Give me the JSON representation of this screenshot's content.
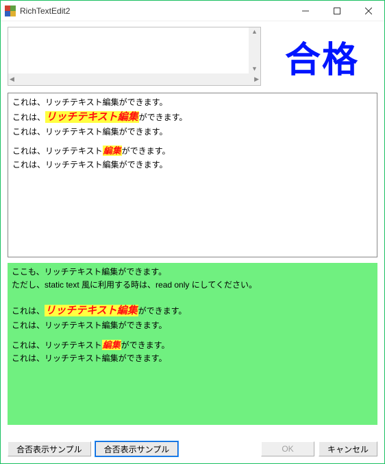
{
  "window": {
    "title": "RichTextEdit2"
  },
  "topright": {
    "pass_label": "合格"
  },
  "rich1": {
    "l1_full": "これは、リッチテキスト編集ができます。",
    "l2_pre": "これは、",
    "l2_mid": "リッチテキスト編集",
    "l2_post": "ができます。",
    "l3_full": "これは、リッチテキスト編集ができます。",
    "l4_pre": "これは、リッチテキスト",
    "l4_mid": "編集",
    "l4_post": "ができます。",
    "l5_full": "これは、リッチテキスト編集ができます。"
  },
  "rich2": {
    "intro1": "ここも、リッチテキスト編集ができます。",
    "intro2": "ただし、static text 風に利用する時は、read only にしてください。",
    "l2_pre": "これは、",
    "l2_mid": "リッチテキスト編集",
    "l2_post": "ができます。",
    "l3_full": "これは、リッチテキスト編集ができます。",
    "l4_pre": "これは、リッチテキスト",
    "l4_mid": "編集",
    "l4_post": "ができます。",
    "l5_full": "これは、リッチテキスト編集ができます。"
  },
  "buttons": {
    "sample1": "合否表示サンプル",
    "sample2": "合否表示サンプル",
    "ok": "OK",
    "cancel": "キャンセル"
  }
}
